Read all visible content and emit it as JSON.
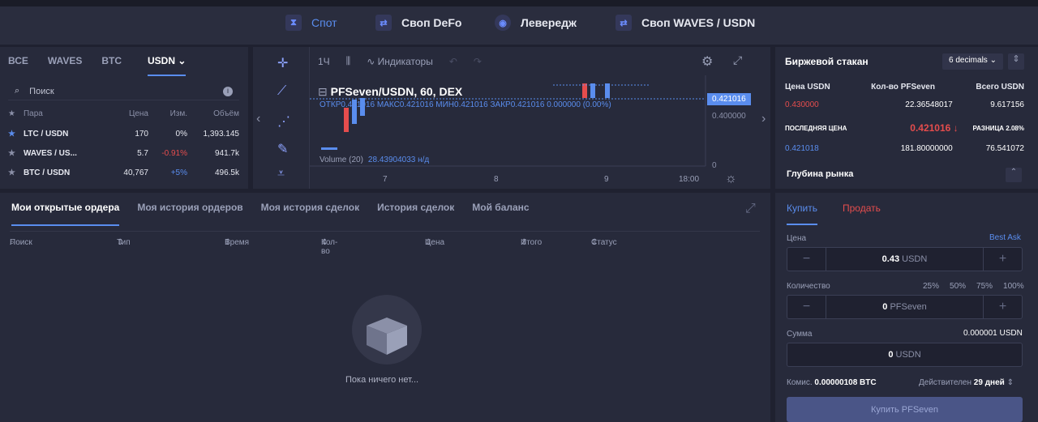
{
  "topnav": {
    "tabs": [
      {
        "label": "Спот"
      },
      {
        "label": "Своп DeFo"
      },
      {
        "label": "Левередж"
      },
      {
        "label": "Своп WAVES / USDN"
      }
    ]
  },
  "markets": {
    "tabs": [
      "ВСЕ",
      "WAVES",
      "BTC",
      "USDN"
    ],
    "search_placeholder": "Поиск",
    "columns": [
      "Пара",
      "Цена",
      "Изм.",
      "Объём"
    ],
    "rows": [
      {
        "pair": "LTC / USDN",
        "price": "170",
        "change": "0%",
        "volume": "1,393.145"
      },
      {
        "pair": "WAVES / US...",
        "price": "5.7",
        "change": "-0.91%",
        "volume": "941.7k"
      },
      {
        "pair": "BTC / USDN",
        "price": "40,767",
        "change": "+5%",
        "volume": "496.5k"
      }
    ]
  },
  "chart": {
    "interval": "1Ч",
    "indicators": "Индикаторы",
    "symbol": "PFSeven/USDN, 60, DEX",
    "ohlc": "ОТКР0.421016 МАКС0.421016 МИН0.421016 ЗАКР0.421016 0.000000 (0.00%)",
    "volume_label": "Volume (20)",
    "volume_value": "28.43904033 н/д",
    "price_label": "0.421016",
    "price_tick": "0.400000",
    "price_zero": "0",
    "x_ticks": [
      "7",
      "8",
      "9",
      "18:00"
    ]
  },
  "orderbook": {
    "title": "Биржевой стакан",
    "decimals": "6 decimals",
    "col1": "Цена USDN",
    "col2": "Кол-во PFSeven",
    "col3": "Всего USDN",
    "ask": {
      "price": "0.430000",
      "qty": "22.36548017",
      "total": "9.617156"
    },
    "last_label": "ПОСЛЕДНЯЯ ЦЕНА",
    "last_price": "0.421016 ↓",
    "spread": "РАЗНИЦА 2.08%",
    "bid": {
      "price": "0.421018",
      "qty": "181.80000000",
      "total": "76.541072"
    },
    "depth": "Глубина рынка"
  },
  "orders": {
    "tabs": [
      "Мои открытые ордера",
      "Моя история ордеров",
      "Моя история сделок",
      "История сделок",
      "Мой баланс"
    ],
    "columns": [
      "Поиск",
      "Тип",
      "Время",
      "Кол-во",
      "Цена",
      "Итого",
      "Статус"
    ],
    "empty": "Пока ничего нет..."
  },
  "trade": {
    "buy_tab": "Купить",
    "sell_tab": "Продать",
    "price_label": "Цена",
    "best_ask": "Best Ask",
    "price_value": "0.43",
    "price_unit": "USDN",
    "qty_label": "Количество",
    "pcts": [
      "25%",
      "50%",
      "75%",
      "100%"
    ],
    "qty_value": "0",
    "qty_unit": "PFSeven",
    "sum_label": "Сумма",
    "sum_hint": "0.000001 USDN",
    "sum_value": "0",
    "sum_unit": "USDN",
    "fee_label": "Комис.",
    "fee_value": "0.00000108 BTC",
    "valid_label": "Действителен",
    "valid_value": "29 дней",
    "buy_button": "Купить PFSeven"
  },
  "colors": {
    "accent": "#5a8dee",
    "sell": "#e54d4d"
  }
}
